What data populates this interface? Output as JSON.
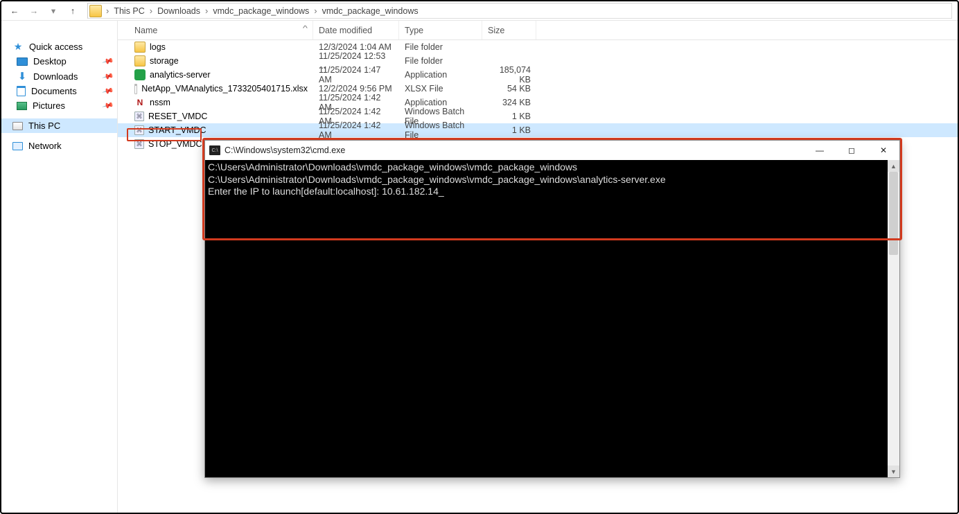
{
  "breadcrumbs": [
    "This PC",
    "Downloads",
    "vmdc_package_windows",
    "vmdc_package_windows"
  ],
  "sidebar": {
    "quick_access": "Quick access",
    "items": [
      "Desktop",
      "Downloads",
      "Documents",
      "Pictures"
    ],
    "this_pc": "This PC",
    "network": "Network"
  },
  "columns": {
    "name": "Name",
    "date": "Date modified",
    "type": "Type",
    "size": "Size"
  },
  "files": [
    {
      "name": "logs",
      "date": "12/3/2024 1:04 AM",
      "type": "File folder",
      "size": "",
      "icon": "folder"
    },
    {
      "name": "storage",
      "date": "11/25/2024 12:53 ...",
      "type": "File folder",
      "size": "",
      "icon": "folder"
    },
    {
      "name": "analytics-server",
      "date": "11/25/2024 1:47 AM",
      "type": "Application",
      "size": "185,074 KB",
      "icon": "app"
    },
    {
      "name": "NetApp_VMAnalytics_1733205401715.xlsx",
      "date": "12/2/2024 9:56 PM",
      "type": "XLSX File",
      "size": "54 KB",
      "icon": "xlsx"
    },
    {
      "name": "nssm",
      "date": "11/25/2024 1:42 AM",
      "type": "Application",
      "size": "324 KB",
      "icon": "nssm"
    },
    {
      "name": "RESET_VMDC",
      "date": "11/25/2024 1:42 AM",
      "type": "Windows Batch File",
      "size": "1 KB",
      "icon": "bat"
    },
    {
      "name": "START_VMDC",
      "date": "11/25/2024 1:42 AM",
      "type": "Windows Batch File",
      "size": "1 KB",
      "icon": "bat",
      "selected": true
    },
    {
      "name": "STOP_VMDC",
      "date": "",
      "type": "",
      "size": "",
      "icon": "bat"
    }
  ],
  "cmd": {
    "title": "C:\\Windows\\system32\\cmd.exe",
    "lines": [
      "C:\\Users\\Administrator\\Downloads\\vmdc_package_windows\\vmdc_package_windows",
      "C:\\Users\\Administrator\\Downloads\\vmdc_package_windows\\vmdc_package_windows\\analytics-server.exe",
      "Enter the IP to launch[default:localhost]: 10.61.182.14"
    ]
  }
}
